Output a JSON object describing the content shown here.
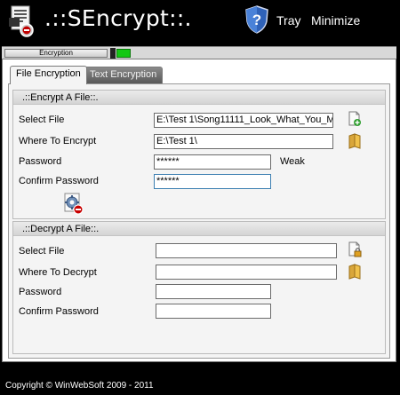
{
  "header": {
    "title": ".::SEncrypt::.",
    "tray_label": "Tray",
    "minimize_label": "Minimize"
  },
  "status": {
    "progress_label": "Encryption",
    "progress_fraction": 0.05
  },
  "tabs": [
    {
      "label": "File Encryption",
      "active": true
    },
    {
      "label": "Text Encryption",
      "active": false
    }
  ],
  "encrypt": {
    "title": ".::Encrypt A File::.",
    "select_file_label": "Select File",
    "select_file_value": "E:\\Test 1\\Song11111_Look_What_You_M",
    "where_label": "Where To Encrypt",
    "where_value": "E:\\Test 1\\",
    "password_label": "Password",
    "password_value": "******",
    "strength": "Weak",
    "confirm_label": "Confirm Password",
    "confirm_value": "******"
  },
  "decrypt": {
    "title": ".::Decrypt A File::.",
    "select_file_label": "Select File",
    "select_file_value": "",
    "where_label": "Where To Decrypt",
    "where_value": "",
    "password_label": "Password",
    "password_value": "",
    "confirm_label": "Confirm Password",
    "confirm_value": ""
  },
  "footer": {
    "copyright": "Copyright © WinWebSoft 2009 - 2011"
  },
  "colors": {
    "background": "#000000",
    "progress_fill": "#14c814",
    "focus_border": "#3c7fb1"
  },
  "icons": [
    "app-logo-icon",
    "shield-question-icon",
    "add-file-icon",
    "folder-icon",
    "encrypt-gear-icon",
    "lock-file-icon"
  ]
}
